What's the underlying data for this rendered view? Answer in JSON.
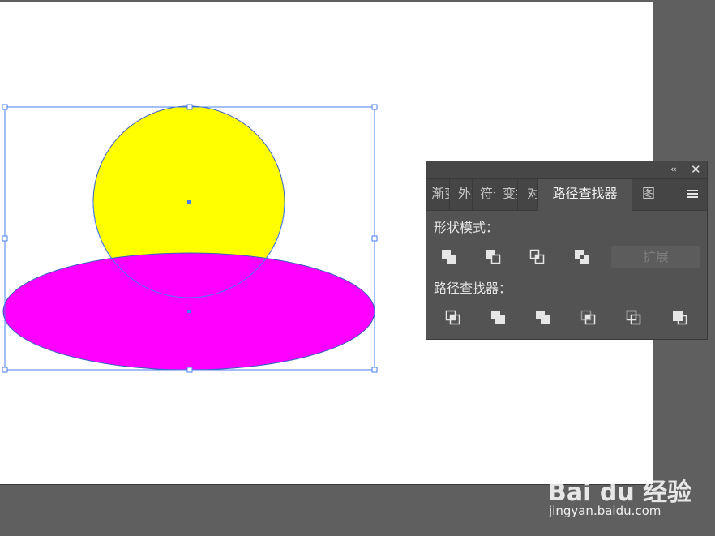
{
  "canvas": {
    "artboard_color": "#ffffff",
    "workspace_color": "#5f5f5f",
    "selection_color": "#4a7cf0",
    "circle_fill": "#ffff00",
    "ellipse_fill": "#ff00ff"
  },
  "panel": {
    "collapse_label": "‹‹",
    "close_label": "✕",
    "tabs": [
      {
        "label": "渐变"
      },
      {
        "label": "外观"
      },
      {
        "label": "符号"
      },
      {
        "label": "变换"
      },
      {
        "label": "对齐"
      },
      {
        "label": "路径查找器"
      },
      {
        "label": "图层"
      }
    ],
    "menu_icon": "hamburger-menu-icon",
    "shape_modes_label": "形状模式：",
    "shape_modes": [
      "unite-icon",
      "minus-front-icon",
      "intersect-icon",
      "exclude-icon"
    ],
    "expand_label": "扩展",
    "pathfinders_label": "路径查找器：",
    "pathfinders": [
      "divide-icon",
      "trim-icon",
      "merge-icon",
      "crop-icon",
      "outline-icon",
      "minus-back-icon"
    ]
  },
  "watermark": {
    "logo": "Bai du 经验",
    "url": "jingyan.baidu.com"
  }
}
